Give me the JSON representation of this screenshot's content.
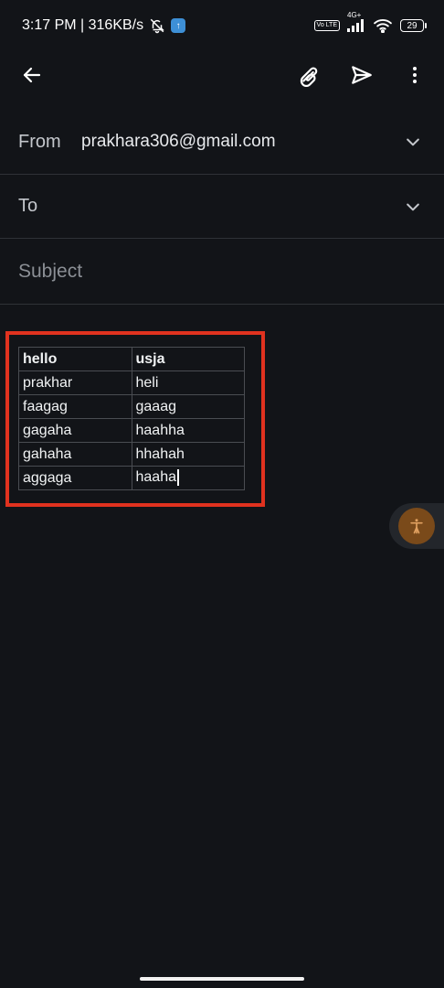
{
  "status_bar": {
    "time_speed": "3:17 PM | 316KB/s",
    "network": "4G+",
    "volte": "Vo LTE",
    "battery": "29"
  },
  "toolbar": {
    "back_icon": "arrow-left-icon",
    "attach_icon": "paperclip-icon",
    "send_icon": "send-icon",
    "more_icon": "more-vert-icon"
  },
  "compose": {
    "from_label": "From",
    "from_value": "prakhara306@gmail.com",
    "to_label": "To",
    "subject_placeholder": "Subject"
  },
  "table": {
    "header": [
      "hello",
      "usja"
    ],
    "rows": [
      [
        "prakhar",
        "heli"
      ],
      [
        "faagag",
        "gaaag"
      ],
      [
        "gagaha",
        "haahha"
      ],
      [
        "gahaha",
        "hhahah"
      ],
      [
        "aggaga",
        "haaha"
      ]
    ]
  },
  "colors": {
    "background": "#121418",
    "highlight_border": "#e0321f",
    "divider": "#2f3237"
  }
}
